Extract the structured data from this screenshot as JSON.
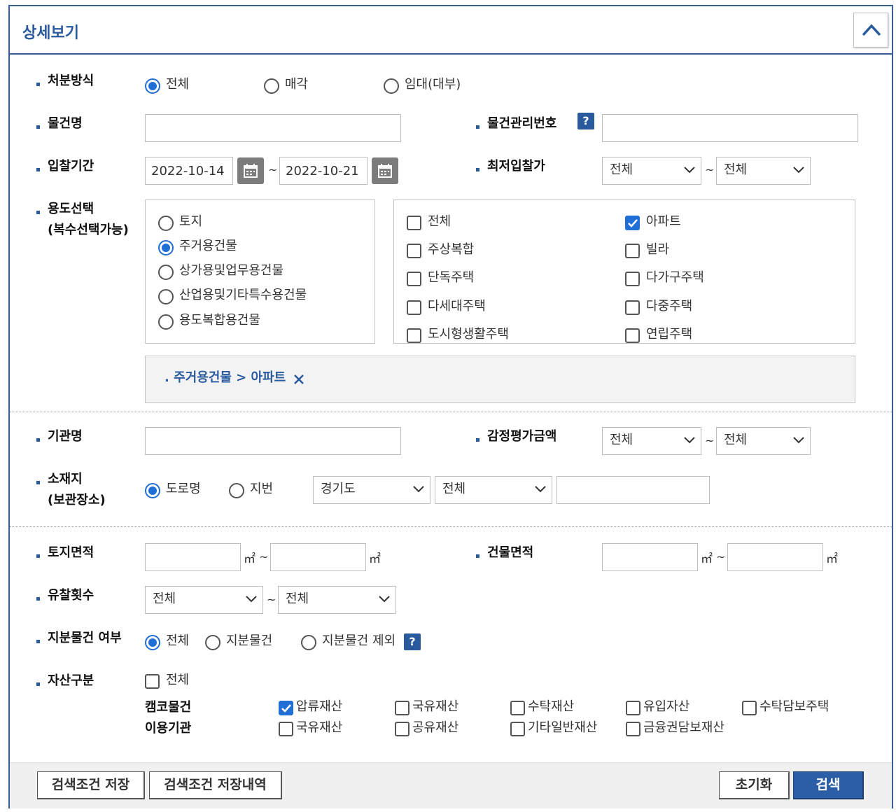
{
  "header": {
    "title": "상세보기"
  },
  "fields": {
    "disposal": {
      "label": "처분방식",
      "options": [
        "전체",
        "매각",
        "임대(대부)"
      ]
    },
    "item_name": {
      "label": "물건명",
      "value": ""
    },
    "item_no": {
      "label": "물건관리번호",
      "value": ""
    },
    "bid_period": {
      "label": "입찰기간",
      "start": "2022-10-14",
      "end": "2022-10-21"
    },
    "min_bid": {
      "label": "최저입찰가",
      "from": "전체",
      "to": "전체"
    },
    "usage": {
      "label": "용도선택",
      "label2": "(복수선택가능)",
      "categories": [
        "토지",
        "주거용건물",
        "상가용및업무용건물",
        "산업용및기타특수용건물",
        "용도복합용건물"
      ],
      "subtypes_left": [
        "전체",
        "주상복합",
        "단독주택",
        "다세대주택",
        "도시형생활주택"
      ],
      "subtypes_right": [
        "아파트",
        "빌라",
        "다가구주택",
        "다중주택",
        "연립주택"
      ],
      "selected_text": ". 주거용건물 > 아파트"
    },
    "org": {
      "label": "기관명",
      "value": ""
    },
    "appraisal": {
      "label": "감정평가금액",
      "from": "전체",
      "to": "전체"
    },
    "location": {
      "label": "소재지",
      "label2": "(보관장소)",
      "types": [
        "도로명",
        "지번"
      ],
      "province": "경기도",
      "city": "전체",
      "detail": ""
    },
    "land_area": {
      "label": "토지면적",
      "unit": "㎡",
      "tilde": "~"
    },
    "building_area": {
      "label": "건물면적",
      "unit": "㎡",
      "tilde": "~"
    },
    "fail_count": {
      "label": "유찰횟수",
      "from": "전체",
      "to": "전체"
    },
    "share": {
      "label": "지분물건 여부",
      "options": [
        "전체",
        "지분물건",
        "지분물건 제외"
      ]
    },
    "asset": {
      "label": "자산구분",
      "all": "전체",
      "row1_label": "캠코물건",
      "row1": [
        "압류재산",
        "국유재산",
        "수탁재산",
        "유입자산",
        "수탁담보주택"
      ],
      "row2_label": "이용기관",
      "row2": [
        "국유재산",
        "공유재산",
        "기타일반재산",
        "금융권담보재산"
      ]
    }
  },
  "footer": {
    "save": "검색조건 저장",
    "history": "검색조건 저장내역",
    "reset": "초기화",
    "search": "검색"
  },
  "tilde": "~",
  "help": "?",
  "colors": {
    "accent": "#2a5a9e",
    "primary_button": "#2c5ea8",
    "check": "#1f6fd6"
  }
}
